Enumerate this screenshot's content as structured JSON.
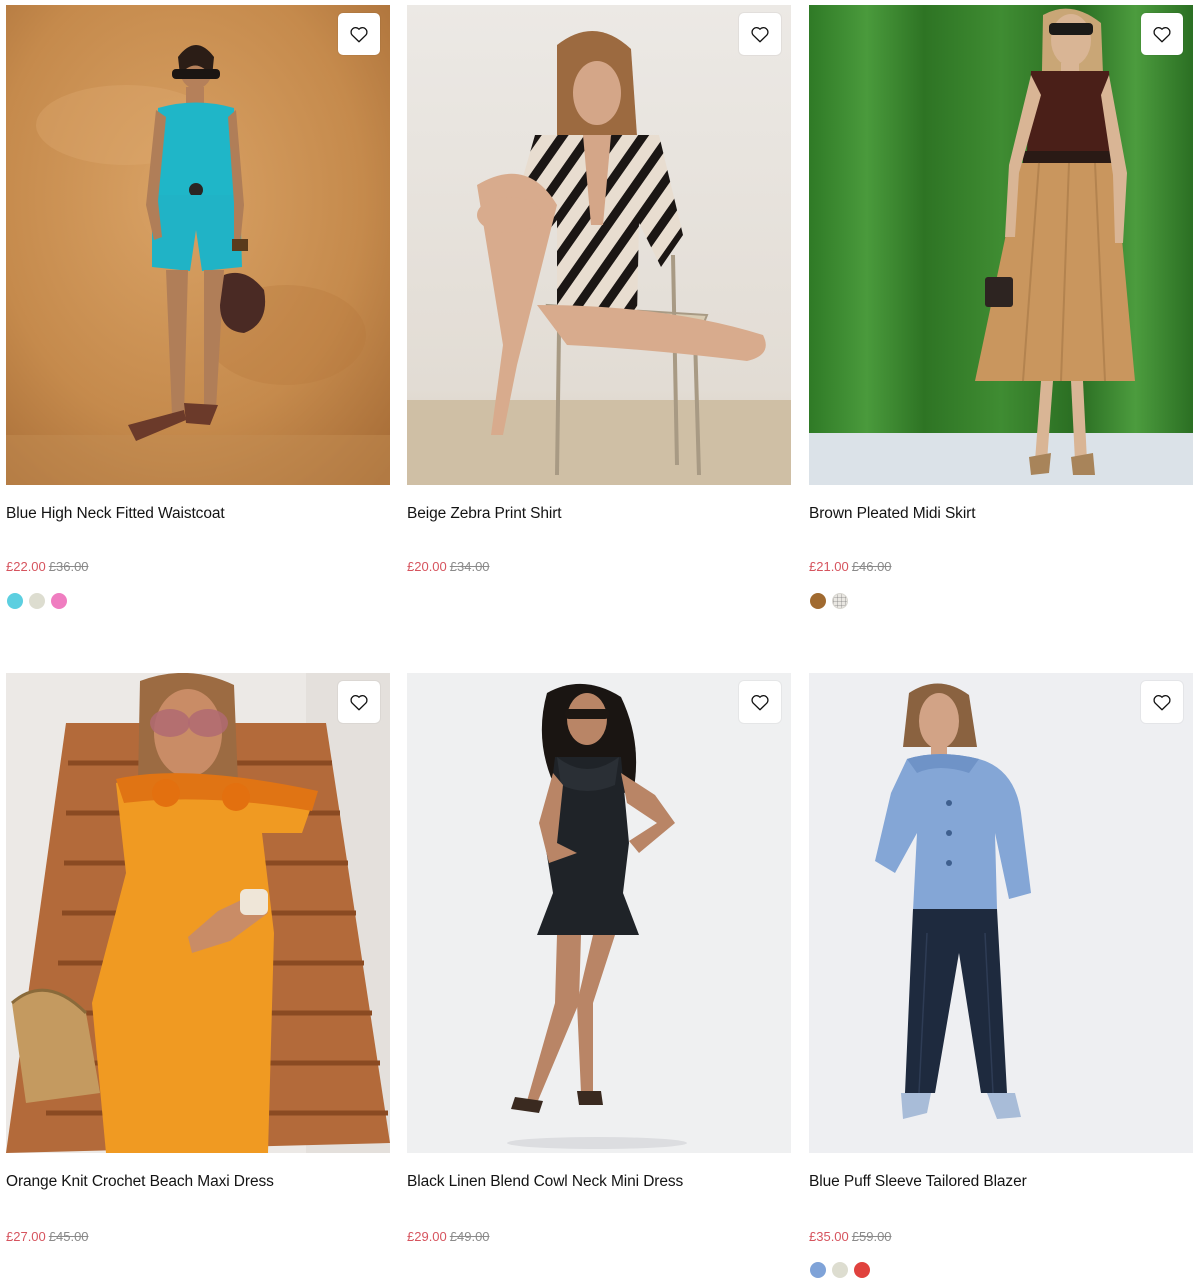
{
  "colors": {
    "sale_price": "#d6545e",
    "was_price": "#8a8a8a",
    "title_text": "#141414"
  },
  "wishlist": {
    "icon": "heart-outline-icon"
  },
  "products": [
    {
      "name": "Blue High Neck Fitted Waistcoat",
      "price_now": "£22.00",
      "price_was": "£36.00",
      "swatches": [
        "#5ccfe0",
        "#ddddd0",
        "#ef7dc0"
      ]
    },
    {
      "name": "Beige Zebra Print Shirt",
      "price_now": "£20.00",
      "price_was": "£34.00",
      "swatches": []
    },
    {
      "name": "Brown Pleated Midi Skirt",
      "price_now": "£21.00",
      "price_was": "£46.00",
      "swatches": [
        "#a06a30",
        "check-pattern"
      ]
    },
    {
      "name": "Orange Knit Crochet Beach Maxi Dress",
      "price_now": "£27.00",
      "price_was": "£45.00",
      "swatches": []
    },
    {
      "name": "Black Linen Blend Cowl Neck Mini Dress",
      "price_now": "£29.00",
      "price_was": "£49.00",
      "swatches": []
    },
    {
      "name": "Blue Puff Sleeve Tailored Blazer",
      "price_now": "£35.00",
      "price_was": "£59.00",
      "swatches": [
        "#7fa3d8",
        "#ddddd0",
        "#e0423e"
      ]
    }
  ]
}
